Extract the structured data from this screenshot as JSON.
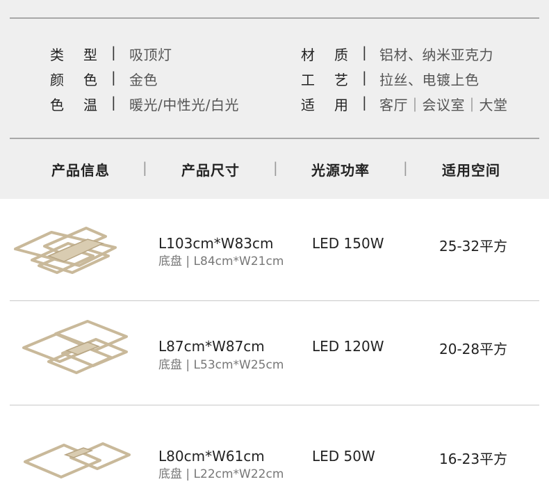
{
  "specs": {
    "left": [
      {
        "label": "类型",
        "value": "吸顶灯"
      },
      {
        "label": "颜色",
        "value": "金色"
      },
      {
        "label": "色温",
        "value": "暖光/中性光/白光"
      }
    ],
    "right": [
      {
        "label": "材质",
        "value": "铝材、纳米亚克力"
      },
      {
        "label": "工艺",
        "value": "拉丝、电镀上色"
      },
      {
        "label": "适用",
        "value": "客厅｜会议室｜大堂"
      }
    ],
    "separator": "|"
  },
  "table": {
    "headers": [
      "产品信息",
      "产品尺寸",
      "光源功率",
      "适用空间"
    ],
    "header_separator": "|",
    "rows": [
      {
        "size": "L103cm*W83cm",
        "base_label": "底盘",
        "base_sep": "|",
        "base": "L84cm*W21cm",
        "power": "LED 150W",
        "space": "25-32平方"
      },
      {
        "size": "L87cm*W87cm",
        "base_label": "底盘",
        "base_sep": "|",
        "base": "L53cm*W25cm",
        "power": "LED 120W",
        "space": "20-28平方"
      },
      {
        "size": "L80cm*W61cm",
        "base_label": "底盘",
        "base_sep": "|",
        "base": "L22cm*W22cm",
        "power": "LED 50W",
        "space": "16-23平方"
      }
    ]
  },
  "colors": {
    "top_background": "#efefef",
    "lamp_gold": "#c9b99a",
    "text_dark": "#222222",
    "text_muted": "#777777"
  },
  "icons": [
    "ceiling-lamp-image-1",
    "ceiling-lamp-image-2",
    "ceiling-lamp-image-3"
  ]
}
